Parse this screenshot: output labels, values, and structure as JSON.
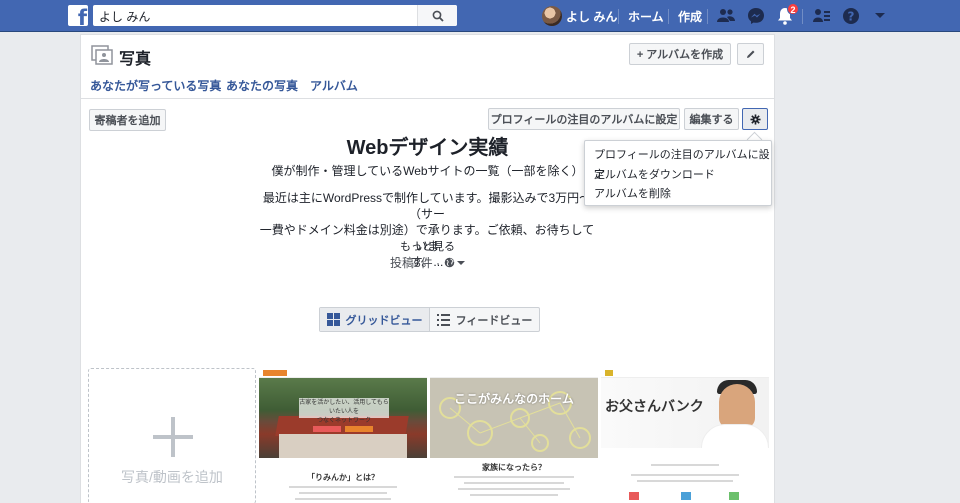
{
  "topbar": {
    "search_value": "よし みん",
    "user_name": "よし みん",
    "home_label": "ホーム",
    "create_label": "作成",
    "notification_count": "2"
  },
  "header": {
    "title": "写真",
    "create_album_label": "+ アルバムを作成",
    "tabs": [
      "あなたが写っている写真",
      "あなたの写真",
      "アルバム"
    ]
  },
  "album": {
    "add_contributor_label": "寄稿者を追加",
    "feature_label": "プロフィールの注目のアルバムに設定",
    "edit_label": "編集する",
    "title": "Webデザイン実績",
    "subtitle": "僕が制作・管理しているWebサイトの一覧（一部を除く）",
    "description_line1": "最近は主にWordPressで制作しています。撮影込みで3万円〜（サー",
    "description_line2": "一費やドメイン料金は別途）で承ります。ご依頼、お待ちしていま",
    "description_line3": "す。...",
    "see_more": "もっと見る",
    "post_count": "投稿3件 ·"
  },
  "dropdown": {
    "items": [
      "プロフィールの注目のアルバムに設定",
      "アルバムをダウンロード",
      "アルバムを削除"
    ]
  },
  "view_toggle": {
    "grid_label": "グリッドビュー",
    "feed_label": "フィードビュー"
  },
  "grid": {
    "add_label": "写真/動画を追加",
    "thumb1": {
      "band_text_1": "古家を活かしたい、活用してもらいたい人を",
      "band_text_2": "つなぐネットワーク",
      "question": "「りみんか」とは？"
    },
    "thumb2": {
      "title": "ここがみんなのホーム",
      "subtitle": "家族になったら？"
    },
    "thumb3": {
      "title": "お父さんバンク"
    }
  },
  "colors": {
    "brand_blue": "#4267b2",
    "link_blue": "#365899",
    "badge_red": "#fa3e3e"
  }
}
